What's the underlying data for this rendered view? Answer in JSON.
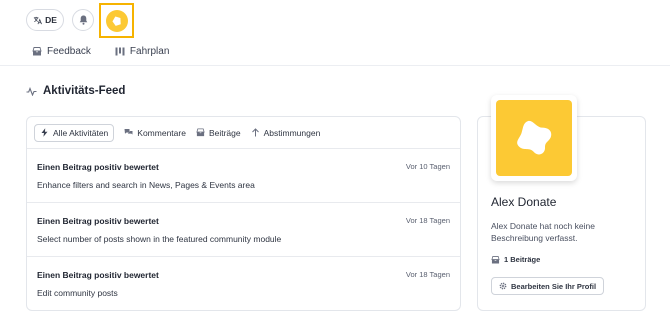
{
  "header": {
    "language_label": "DE",
    "nav": [
      {
        "label": "Feedback",
        "icon": "inbox-icon"
      },
      {
        "label": "Fahrplan",
        "icon": "roadmap-icon"
      }
    ]
  },
  "feed": {
    "title": "Aktivitäts-Feed",
    "filters": [
      {
        "label": "Alle Aktivitäten",
        "icon": "bolt-icon",
        "active": true
      },
      {
        "label": "Kommentare",
        "icon": "comments-icon",
        "active": false
      },
      {
        "label": "Beiträge",
        "icon": "inbox-icon",
        "active": false
      },
      {
        "label": "Abstimmungen",
        "icon": "arrow-up-icon",
        "active": false
      }
    ],
    "items": [
      {
        "title": "Einen Beitrag positiv bewertet",
        "time": "Vor 10 Tagen",
        "description": "Enhance filters and search in News, Pages & Events area"
      },
      {
        "title": "Einen Beitrag positiv bewertet",
        "time": "Vor 18 Tagen",
        "description": "Select number of posts shown in the featured community module"
      },
      {
        "title": "Einen Beitrag positiv bewertet",
        "time": "Vor 18 Tagen",
        "description": "Edit community posts"
      }
    ]
  },
  "profile": {
    "name": "Alex Donate",
    "description": "Alex Donate hat noch keine Beschreibung verfasst.",
    "posts": "1 Beiträge",
    "edit_label": "Bearbeiten Sie Ihr Profil"
  },
  "colors": {
    "accent_yellow": "#fcc934",
    "highlight_border": "#f6b300"
  }
}
